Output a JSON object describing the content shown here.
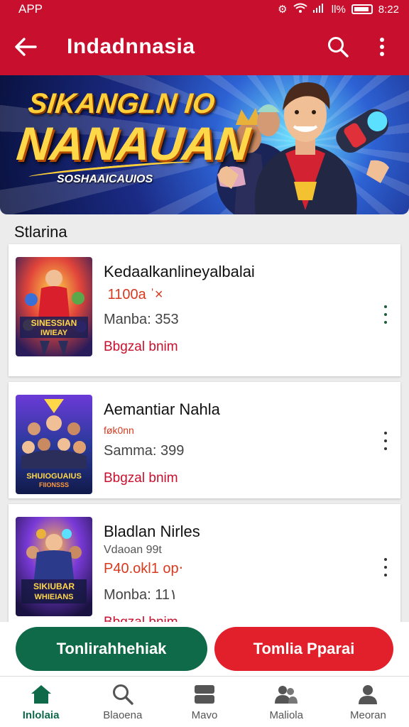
{
  "status": {
    "left": "APP",
    "battery": " ll%",
    "time": "8:22"
  },
  "appbar": {
    "title": "Indadnnasia"
  },
  "banner": {
    "line1": "SIKANGLN IO",
    "line2": "NANAUAN",
    "subtitle": "SOSHAAICAUIOS"
  },
  "section": {
    "title": "Stlarina"
  },
  "items": [
    {
      "title": "Kedaalkanlineyalbalai",
      "price": " 1100a  ˈ×",
      "meta": "Manba: 353",
      "link": "Bbgzal bnim"
    },
    {
      "title": "Aemantiar Nahla",
      "price": "føk0nn",
      "meta": "Samma: 399",
      "link": "Bbgzal bnim"
    },
    {
      "title": "Bladlan Nirles",
      "sub": "Vdaoan 99t",
      "price": "P40.okl1 op‧",
      "meta": "Monba: 11١",
      "link": "Bbgzal bnim"
    }
  ],
  "actions": {
    "primary": "Tonlirahhehiak",
    "secondary": "Tomlia Pparai"
  },
  "nav": [
    {
      "label": "Inlolaia",
      "icon": "home-icon"
    },
    {
      "label": "Blaoena",
      "icon": "search-icon"
    },
    {
      "label": "Mavo",
      "icon": "folder-icon"
    },
    {
      "label": "Maliola",
      "icon": "people-icon"
    },
    {
      "label": "Meoran",
      "icon": "person-icon"
    }
  ],
  "colors": {
    "primary": "#c8102e",
    "green": "#0f6a4a",
    "red_button": "#e2202b"
  }
}
